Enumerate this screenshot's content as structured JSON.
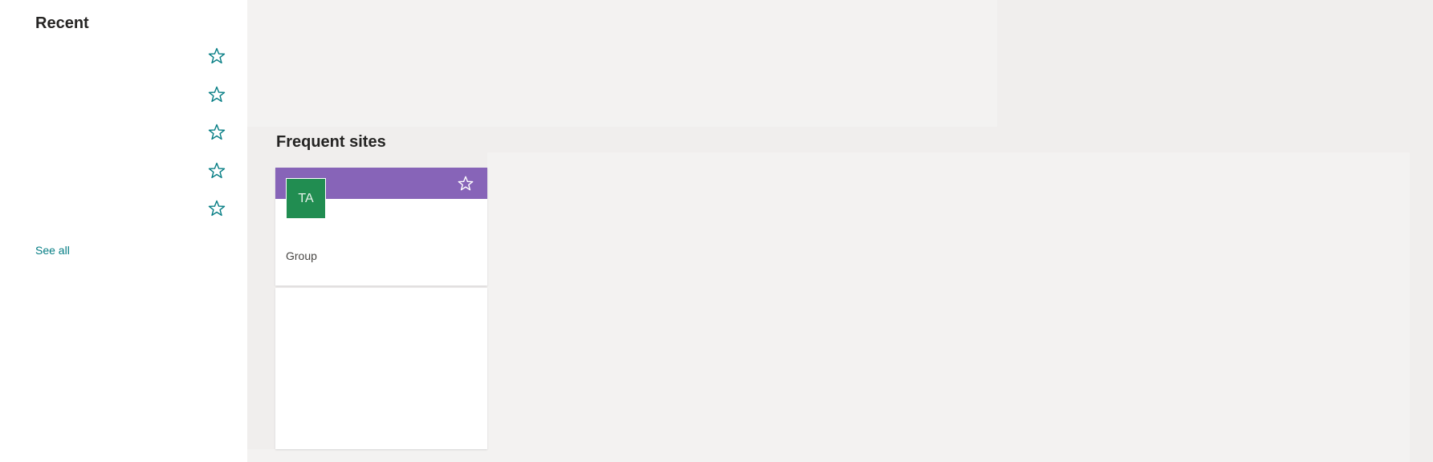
{
  "sidebar": {
    "title": "Recent",
    "items": [
      {
        "icon": "star-outline-icon"
      },
      {
        "icon": "star-outline-icon"
      },
      {
        "icon": "star-outline-icon"
      },
      {
        "icon": "star-outline-icon"
      },
      {
        "icon": "star-outline-icon"
      }
    ],
    "see_all_label": "See all",
    "accent_color": "#037c83"
  },
  "main": {
    "frequent_title": "Frequent sites",
    "sites": [
      {
        "initials": "TA",
        "label": "Group",
        "banner_color": "#8764b8",
        "avatar_color": "#218d51",
        "icon": "star-outline-icon"
      }
    ]
  }
}
